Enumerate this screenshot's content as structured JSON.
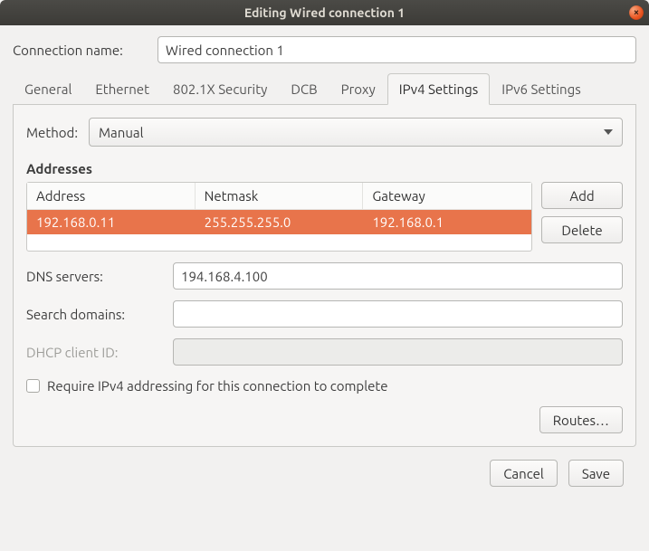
{
  "window": {
    "title": "Editing Wired connection 1"
  },
  "connection_name": {
    "label": "Connection name:",
    "value": "Wired connection 1"
  },
  "tabs": [
    {
      "label": "General"
    },
    {
      "label": "Ethernet"
    },
    {
      "label": "802.1X Security"
    },
    {
      "label": "DCB"
    },
    {
      "label": "Proxy"
    },
    {
      "label": "IPv4 Settings"
    },
    {
      "label": "IPv6 Settings"
    }
  ],
  "active_tab_index": 5,
  "ipv4": {
    "method_label": "Method:",
    "method_value": "Manual",
    "addresses_heading": "Addresses",
    "columns": {
      "address": "Address",
      "netmask": "Netmask",
      "gateway": "Gateway"
    },
    "rows": [
      {
        "address": "192.168.0.11",
        "netmask": "255.255.255.0",
        "gateway": "192.168.0.1",
        "selected": true
      }
    ],
    "buttons": {
      "add": "Add",
      "delete": "Delete",
      "routes": "Routes…"
    },
    "dns_label": "DNS servers:",
    "dns_value": "194.168.4.100",
    "search_label": "Search domains:",
    "search_value": "",
    "dhcp_label": "DHCP client ID:",
    "dhcp_value": "",
    "require_label": "Require IPv4 addressing for this connection to complete",
    "require_checked": false
  },
  "footer": {
    "cancel": "Cancel",
    "save": "Save"
  }
}
